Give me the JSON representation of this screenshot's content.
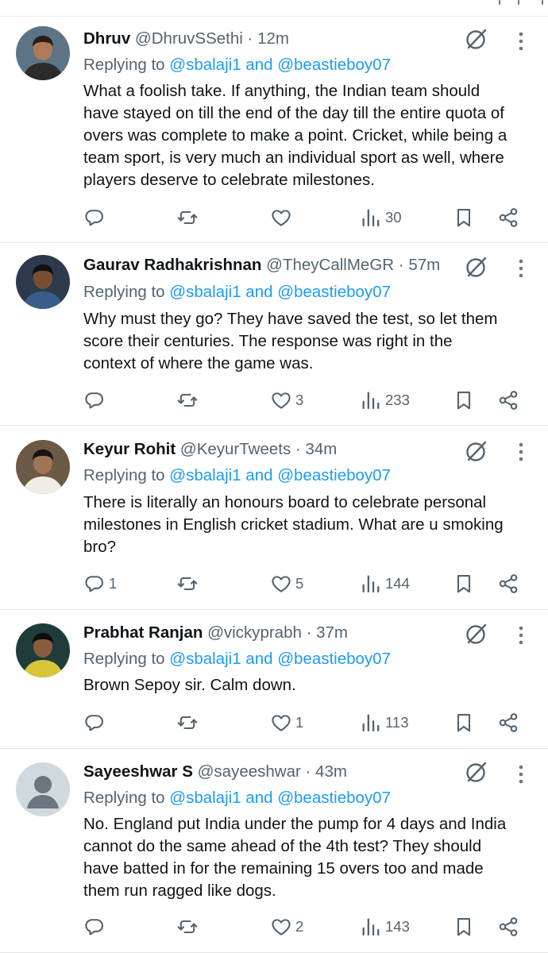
{
  "replying_prefix": "Replying to ",
  "replying_and": " and ",
  "tweets": [
    {
      "name": "Dhruv",
      "handle": "@DhruvSSethi",
      "time": "· 12m",
      "reply_to": [
        "@sbalaji1",
        "@beastieboy07"
      ],
      "text": [
        "What a foolish take. If anything, the Indian team should",
        "have stayed on till the end of the day till the entire quota of",
        "overs was complete to make a point. Cricket, while being a",
        "team sport, is very much an individual sport as well, where",
        "players deserve to celebrate milestones."
      ],
      "counts": {
        "replies": "",
        "retweets": "",
        "likes": "",
        "views": "30"
      },
      "avatar_colors": {
        "bg": "#5d7486",
        "skin": "#b07a56",
        "shirt": "#2b2b2b",
        "hair": "#2a1f18"
      }
    },
    {
      "name": "Gaurav Radhakrishnan",
      "handle": "@TheyCallMeGR",
      "time": "· 57m",
      "reply_to": [
        "@sbalaji1",
        "@beastieboy07"
      ],
      "text": [
        "Why must they go? They have saved the test, so let them",
        "score their centuries. The response was right in the",
        "context of where the game was."
      ],
      "counts": {
        "replies": "",
        "retweets": "",
        "likes": "3",
        "views": "233"
      },
      "avatar_colors": {
        "bg": "#2c3a4c",
        "skin": "#7a4e33",
        "shirt": "#3a5c8a",
        "hair": "#111111"
      }
    },
    {
      "name": "Keyur Rohit",
      "handle": "@KeyurTweets",
      "time": "· 34m",
      "reply_to": [
        "@sbalaji1",
        "@beastieboy07"
      ],
      "text": [
        "There is literally an honours board to celebrate personal",
        "milestones in English cricket stadium. What are u smoking",
        "bro?"
      ],
      "counts": {
        "replies": "1",
        "retweets": "",
        "likes": "5",
        "views": "144"
      },
      "avatar_colors": {
        "bg": "#6b5a45",
        "skin": "#a07456",
        "shirt": "#f0ede6",
        "hair": "#1c1410"
      }
    },
    {
      "name": "Prabhat Ranjan",
      "handle": "@vickyprabh",
      "time": "· 37m",
      "reply_to": [
        "@sbalaji1",
        "@beastieboy07"
      ],
      "text": [
        "Brown Sepoy sir. Calm down."
      ],
      "counts": {
        "replies": "",
        "retweets": "",
        "likes": "1",
        "views": "113"
      },
      "avatar_colors": {
        "bg": "#1f3b3a",
        "skin": "#8a5c3e",
        "shirt": "#d9c43a",
        "hair": "#0d0d0d"
      }
    },
    {
      "name": "Sayeeshwar S",
      "handle": "@sayeeshwar",
      "time": "· 43m",
      "reply_to": [
        "@sbalaji1",
        "@beastieboy07"
      ],
      "text": [
        "No. England put India under the pump for 4 days and India",
        "cannot do the same ahead of the 4th test? They should",
        "have batted in for the remaining 15 overs too and made",
        "them run ragged like dogs."
      ],
      "counts": {
        "replies": "",
        "retweets": "",
        "likes": "2",
        "views": "143"
      },
      "avatar_colors": {
        "bg": "#cfd9de",
        "skin": "#ffffff",
        "shirt": "#ffffff",
        "hair": "#ffffff"
      }
    }
  ],
  "icons": {
    "reply": "reply-icon",
    "retweet": "retweet-icon",
    "like": "heart-icon",
    "views": "views-icon",
    "bookmark": "bookmark-icon",
    "share": "share-icon",
    "grok": "grok-icon",
    "more": "more-icon"
  },
  "colors": {
    "link": "#1d9bf0",
    "text": "#0f1419",
    "secondary": "#536471",
    "divider": "#e3e6e8"
  }
}
